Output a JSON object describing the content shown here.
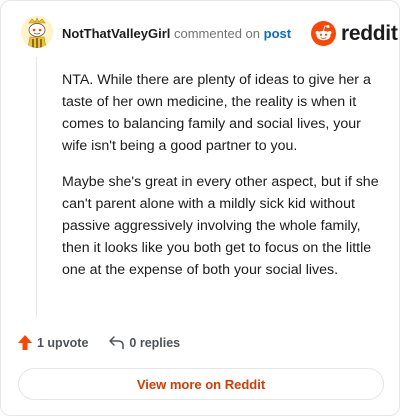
{
  "comment": {
    "username": "NotThatValleyGirl",
    "action_text": "commented on",
    "post_link": "post",
    "avatar_icon": "snoo-avatar-icon",
    "paragraphs": [
      "NTA. While there are plenty of ideas to give her a taste of her own medicine, the reality is when it comes to balancing family and social lives, your wife isn't being a good partner to you.",
      "Maybe she's great in every other aspect, but if she can't parent alone with a mildly sick kid without passive aggressively involving the whole family, then it looks like you both get to focus on the little one at the expense of both your social lives."
    ]
  },
  "brand": {
    "name": "reddit",
    "logo_icon": "reddit-logo-icon",
    "color": "#ff4500"
  },
  "actions": {
    "upvote_icon": "upvote-arrow-icon",
    "upvote_label": "1 upvote",
    "upvote_color": "#ff4500",
    "reply_icon": "reply-arrow-icon",
    "replies_label": "0 replies"
  },
  "footer": {
    "view_more_label": "View more on Reddit",
    "accent": "#d93a00"
  }
}
